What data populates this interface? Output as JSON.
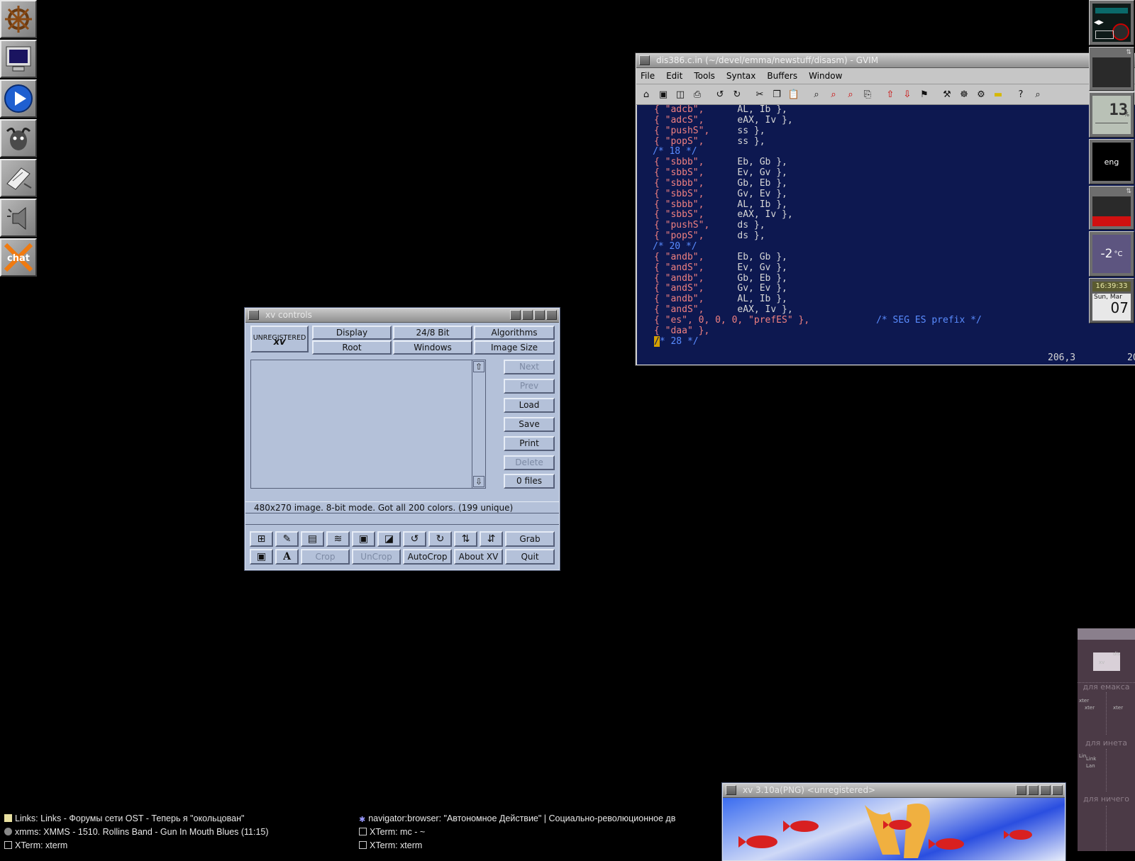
{
  "dock": {
    "items": [
      "wheel-icon",
      "monitor-icon",
      "play-icon",
      "gnu-icon",
      "notepad-icon",
      "speaker-icon",
      "xchat-icon"
    ],
    "xchat_label": "chat"
  },
  "gvim": {
    "title": "dis386.c.in (~/devel/emma/newstuff/disasm) - GVIM",
    "menu": [
      "File",
      "Edit",
      "Tools",
      "Syntax",
      "Buffers",
      "Window"
    ],
    "lines": [
      {
        "s": "{ \"adcb\",",
        "r": "AL, Ib },"
      },
      {
        "s": "{ \"adcS\",",
        "r": "eAX, Iv },"
      },
      {
        "s": "{ \"pushS\",",
        "r": "ss },"
      },
      {
        "s": "{ \"popS\",",
        "r": "ss },"
      },
      {
        "c": "/* 18 */"
      },
      {
        "s": "{ \"sbbb\",",
        "r": "Eb, Gb },"
      },
      {
        "s": "{ \"sbbS\",",
        "r": "Ev, Gv },"
      },
      {
        "s": "{ \"sbbb\",",
        "r": "Gb, Eb },"
      },
      {
        "s": "{ \"sbbS\",",
        "r": "Gv, Ev },"
      },
      {
        "s": "{ \"sbbb\",",
        "r": "AL, Ib },"
      },
      {
        "s": "{ \"sbbS\",",
        "r": "eAX, Iv },"
      },
      {
        "s": "{ \"pushS\",",
        "r": "ds },"
      },
      {
        "s": "{ \"popS\",",
        "r": "ds },"
      },
      {
        "c": "/* 20 */"
      },
      {
        "s": "{ \"andb\",",
        "r": "Eb, Gb },"
      },
      {
        "s": "{ \"andS\",",
        "r": "Ev, Gv },"
      },
      {
        "s": "{ \"andb\",",
        "r": "Gb, Eb },"
      },
      {
        "s": "{ \"andS\",",
        "r": "Gv, Ev },"
      },
      {
        "s": "{ \"andb\",",
        "r": "AL, Ib },"
      },
      {
        "s": "{ \"andS\",",
        "r": "eAX, Iv },"
      },
      {
        "es": "{ \"es\", 0, 0, 0, \"prefES\" },",
        "c2": "/* SEG ES prefix */"
      },
      {
        "s": "{ \"daa\" },",
        "r": ""
      },
      {
        "cur": "/",
        "c": "* 28 */"
      }
    ],
    "ruler": "206,3",
    "ruler_pct": "20"
  },
  "xv": {
    "title": "xv controls",
    "logo_text": "UNREGISTERED",
    "logo_sub": "xv",
    "top_buttons": [
      "Display",
      "24/8 Bit",
      "Algorithms",
      "Root",
      "Windows",
      "Image Size"
    ],
    "side_buttons": [
      "Next",
      "Prev",
      "Load",
      "Save",
      "Print",
      "Delete",
      "0 files"
    ],
    "status": "480x270 image.  8-bit mode.  Got all 200 colors.  (199 unique)",
    "bottom_row1_last": "Grab",
    "bottom_row2": [
      "Crop",
      "UnCrop",
      "AutoCrop",
      "About XV",
      "Quit"
    ],
    "text_tool": "A"
  },
  "dockapps": {
    "cpu": "13",
    "cpu_unit": "%",
    "lang": "eng",
    "temp": "-2",
    "temp_unit": "°C",
    "clock": "16:39:33",
    "date_day": "Sun, Mar",
    "date_num": "07"
  },
  "pager": {
    "desks": [
      "для емакса",
      "для инета",
      "для ничего"
    ],
    "mini1": [
      "dis",
      "xv"
    ],
    "mini2": [
      "xter",
      "xter",
      "xter"
    ],
    "mini3": [
      "Lin",
      "Link",
      "Lan"
    ]
  },
  "xvimg": {
    "title": "xv 3.10a(PNG) <unregistered>"
  },
  "taskbar": {
    "left": [
      "Links: Links - Форумы сети OST - Теперь я \"окольцован\"",
      "xmms: XMMS - 1510. Rollins Band - Gun In Mouth Blues (11:15)",
      "XTerm: xterm"
    ],
    "right": [
      "navigator:browser:  \"Автономное Действие\" | Социально-революционное дв",
      "XTerm: mc - ~",
      "XTerm: xterm"
    ]
  },
  "colors": {
    "xv_bg": "#b4c1d9",
    "vim_bg": "#0d1850",
    "vim_string": "#f08080",
    "vim_comment": "#5a8cff"
  }
}
